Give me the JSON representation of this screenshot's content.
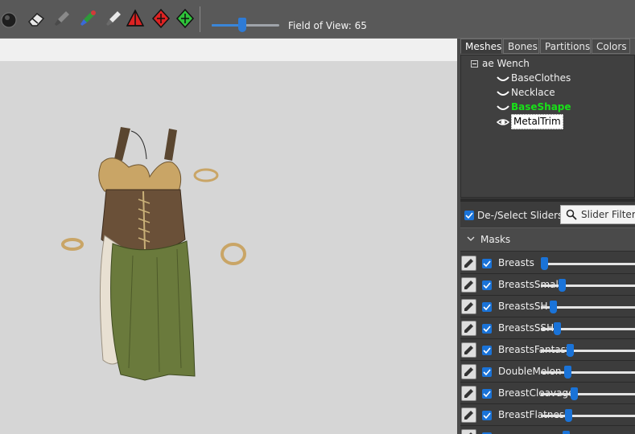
{
  "toolbar": {
    "tools": [
      {
        "icon": "brush-sphere-icon"
      },
      {
        "icon": "eraser-icon"
      },
      {
        "icon": "brush-gray-icon"
      },
      {
        "icon": "brush-color-icon"
      },
      {
        "icon": "brush-white-icon"
      },
      {
        "icon": "transform-icon"
      },
      {
        "icon": "red-diamond-icon"
      },
      {
        "icon": "green-diamond-icon"
      }
    ],
    "fov_label": "Field of View: 65",
    "fov_level": 0.45
  },
  "tabs": [
    "Meshes",
    "Bones",
    "Partitions",
    "Colors"
  ],
  "active_tab": "Meshes",
  "tree": {
    "root": "ae Wench",
    "items": [
      {
        "label": "BaseClothes",
        "state": "normal"
      },
      {
        "label": "Necklace",
        "state": "normal"
      },
      {
        "label": "BaseShape",
        "state": "green"
      },
      {
        "label": "MetalTrim",
        "state": "selected"
      }
    ]
  },
  "select_sliders_label": "De-/Select Sliders",
  "slider_filter_placeholder": "Slider Filter",
  "masks_label": "Masks",
  "sliders": [
    {
      "name": "Breasts",
      "value": 0.0
    },
    {
      "name": "BreastsSmall",
      "value": 0.2
    },
    {
      "name": "BreastsSH",
      "value": 0.1
    },
    {
      "name": "BreastsSSH",
      "value": 0.15
    },
    {
      "name": "BreastsFantasy",
      "value": 0.3
    },
    {
      "name": "DoubleMelon",
      "value": 0.27
    },
    {
      "name": "BreastCleavage",
      "value": 0.34
    },
    {
      "name": "BreastFlatness",
      "value": 0.28
    },
    {
      "name": "",
      "value": 0.25
    }
  ],
  "colors": {
    "accent": "#1a73d8",
    "viewport_bg": "#d6d6d6",
    "panel_bg": "#3c3c3c",
    "highlight_green": "#18e018"
  }
}
